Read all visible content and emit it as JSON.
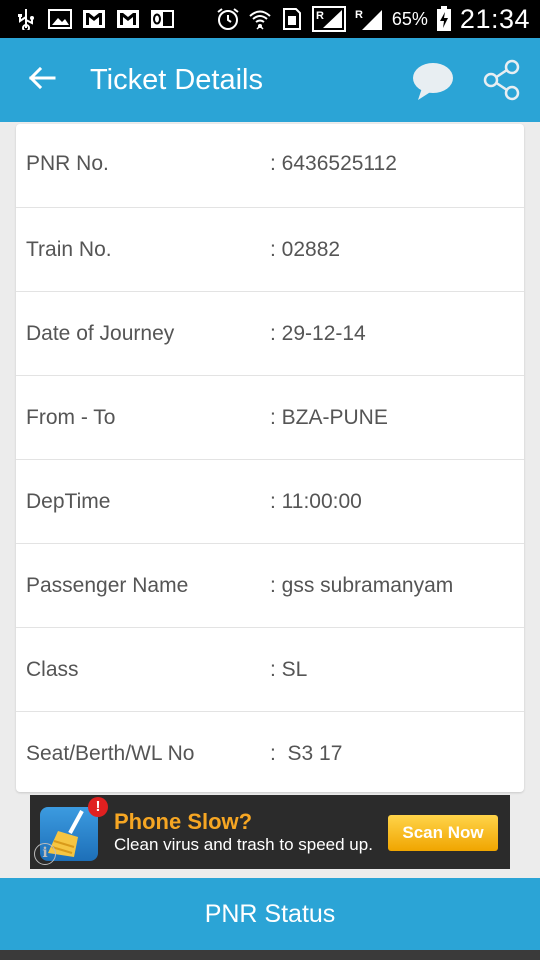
{
  "status_bar": {
    "battery_percent": "65%",
    "time": "21:34",
    "icons": [
      "usb-icon",
      "image-icon",
      "gmail-icon",
      "gmail-icon",
      "outlook-icon",
      "alarm-icon",
      "wifi-icon",
      "sim-icon",
      "signal-r-icon",
      "signal-r-icon",
      "battery-charging-icon"
    ]
  },
  "app_bar": {
    "title": "Ticket Details",
    "back_icon": "arrow-left-icon",
    "chat_icon": "chat-bubble-icon",
    "share_icon": "share-icon"
  },
  "ticket": {
    "rows": [
      {
        "label": "PNR No.",
        "value": ": 6436525112"
      },
      {
        "label": "Train No.",
        "value": ": 02882"
      },
      {
        "label": "Date of Journey",
        "value": ": 29-12-14"
      },
      {
        "label": "From - To",
        "value": ": BZA-PUNE"
      },
      {
        "label": "DepTime",
        "value": ": 11:00:00"
      },
      {
        "label": "Passenger Name",
        "value": ": gss subramanyam"
      },
      {
        "label": "Class",
        "value": ": SL"
      },
      {
        "label": "Seat/Berth/WL No",
        "value": ":  S3 17"
      }
    ]
  },
  "ad": {
    "title": "Phone Slow?",
    "subtitle": "Clean virus and trash to speed up.",
    "button": "Scan Now",
    "badge": "!",
    "info": "i",
    "icon": "broom-icon"
  },
  "bottom_button": {
    "label": "PNR Status"
  },
  "colors": {
    "primary": "#2ba4d6",
    "ad_title": "#f6a623",
    "ad_button": "#f0a500"
  }
}
